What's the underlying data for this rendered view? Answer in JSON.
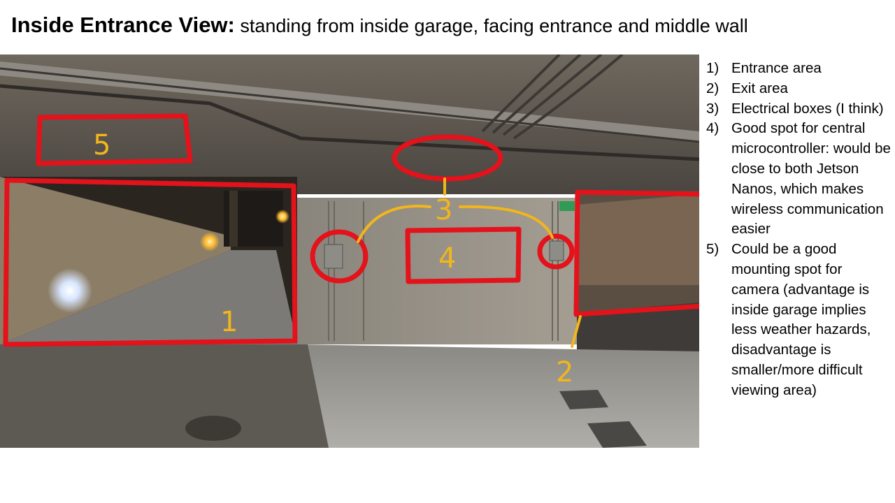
{
  "slide": {
    "title_bold": "Inside Entrance View:",
    "title_rest": " standing from inside garage, facing entrance and middle wall"
  },
  "notes": [
    {
      "num": "1)",
      "text": "Entrance area"
    },
    {
      "num": "2)",
      "text": "Exit area"
    },
    {
      "num": "3)",
      "text": "Electrical boxes (I think)"
    },
    {
      "num": "4)",
      "text": "Good spot for central microcontroller: would be close to both Jetson Nanos, which makes wireless communication easier"
    },
    {
      "num": "5)",
      "text": "Could be a good mounting spot for camera (advantage is inside garage implies less weather hazards, disadvantage is smaller/more difficult viewing area)"
    }
  ],
  "photo": {
    "markers": [
      "5",
      "1",
      "3",
      "4",
      "2"
    ],
    "annotation_color": "#e3121b",
    "label_color": "#f2b51c"
  }
}
